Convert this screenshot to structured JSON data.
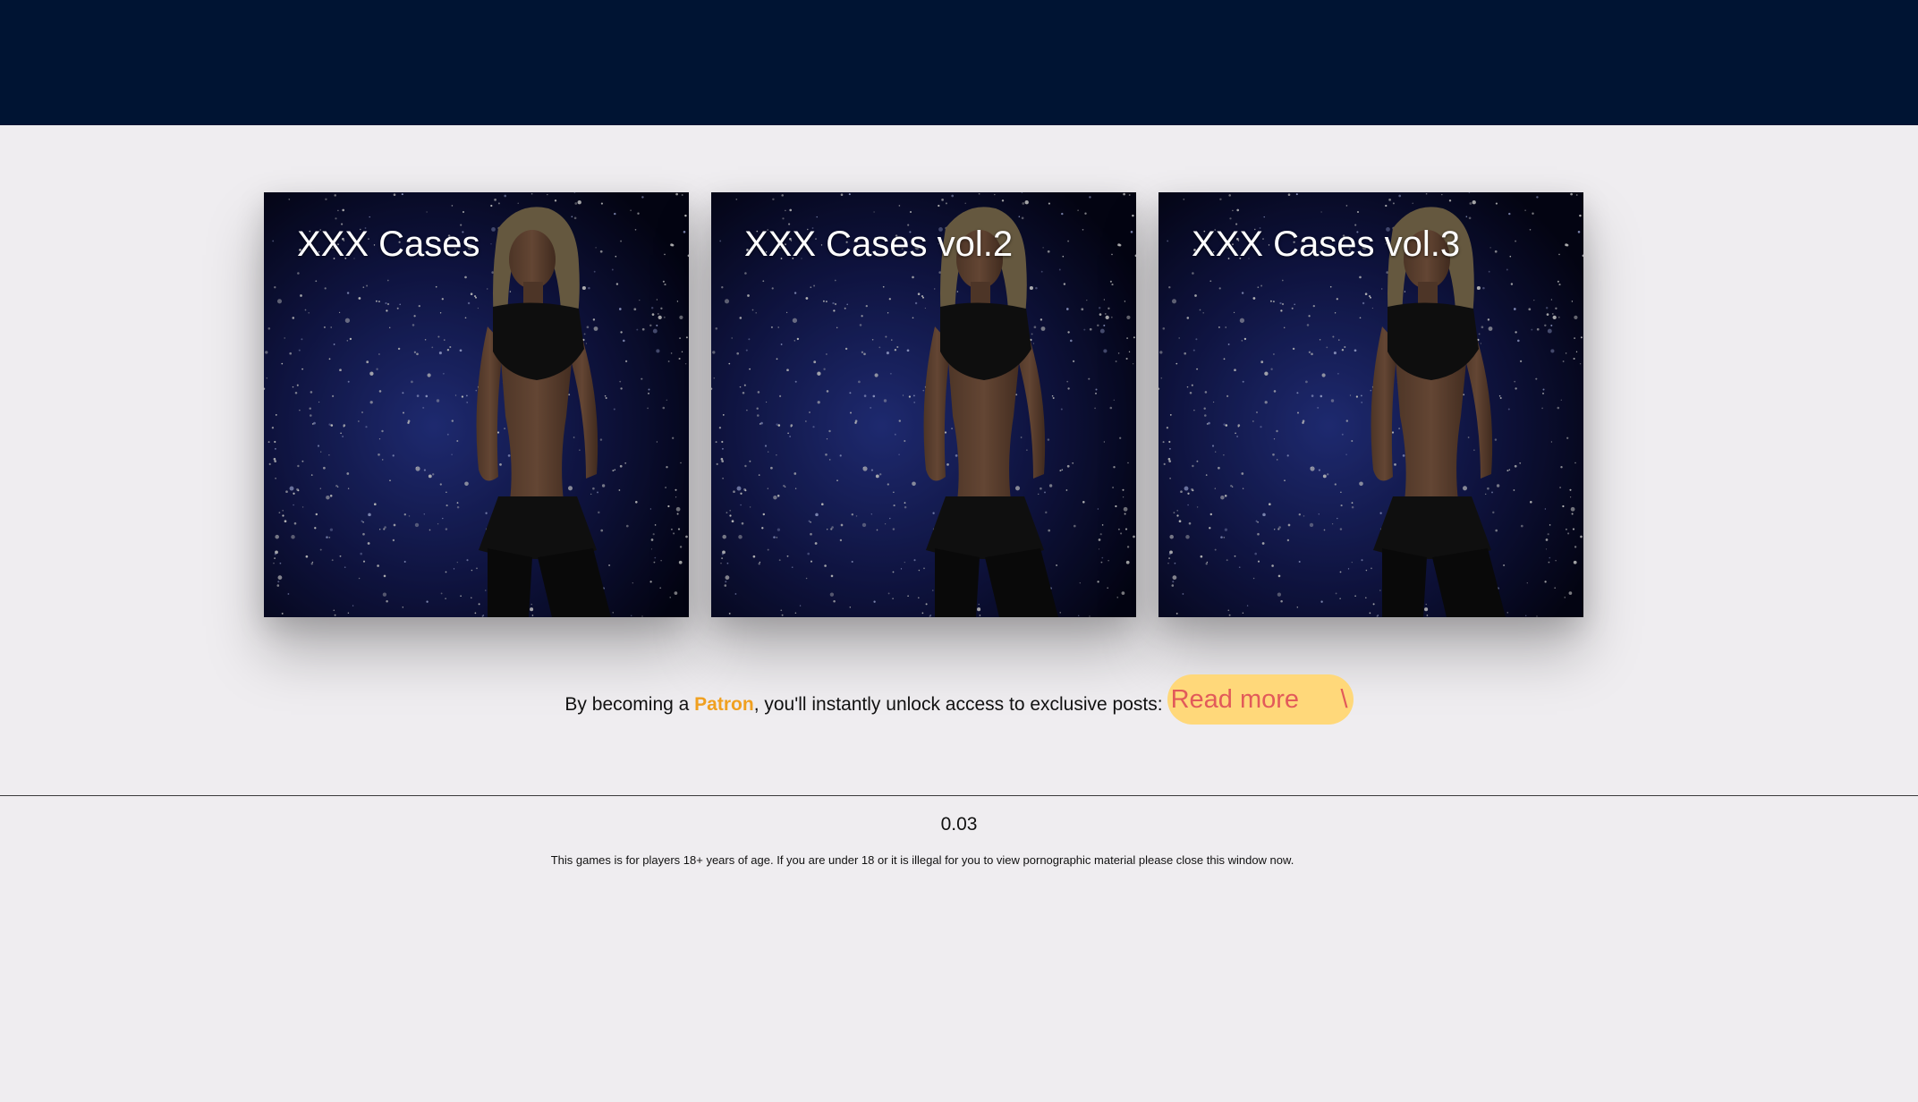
{
  "games": [
    {
      "title": "XXX Cases"
    },
    {
      "title": "XXX Cases vol.2"
    },
    {
      "title": "XXX Cases vol.3"
    }
  ],
  "patron": {
    "prefix": "By becoming a ",
    "highlight": "Patron",
    "suffix": ", you'll instantly unlock access to exclusive posts:",
    "button_label": "Read more",
    "button_trailing": "\\"
  },
  "footer": {
    "version": "0.03",
    "disclaimer": "This games is for players 18+ years of age. If you are under 18 or it is illegal for you to view pornographic material please close this window now."
  },
  "colors": {
    "topbar": "#001433",
    "background": "#efedf0",
    "highlight": "#f0a020",
    "button_bg": "#ffd87a",
    "button_text": "#e25a5a"
  }
}
